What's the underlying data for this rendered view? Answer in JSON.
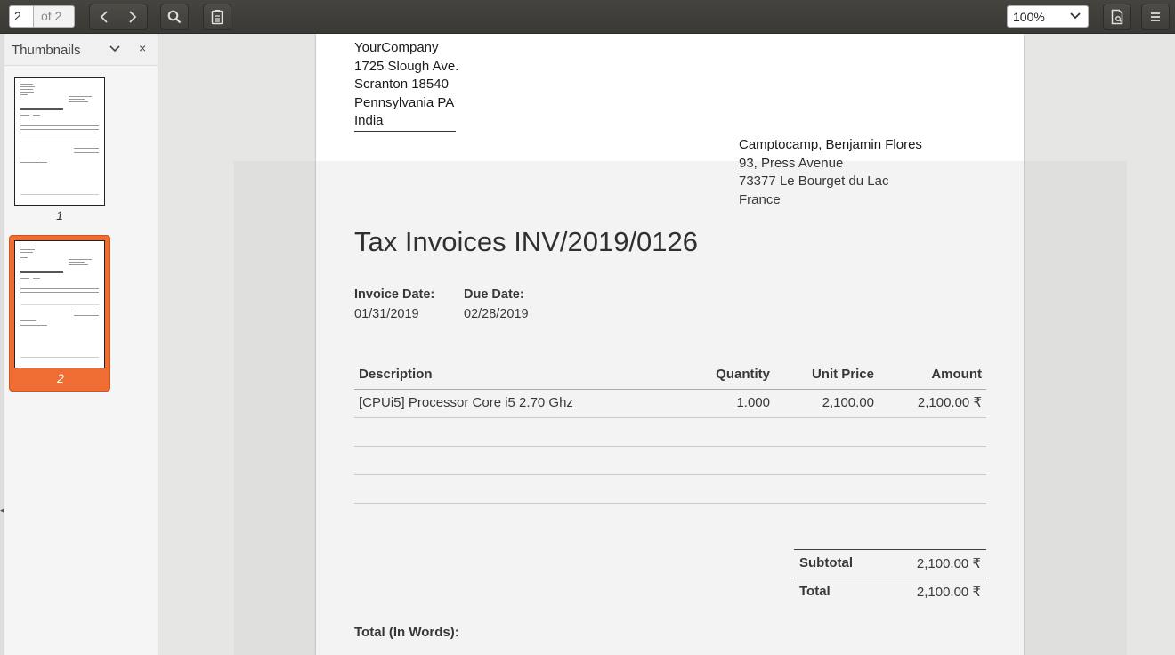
{
  "toolbar": {
    "page_current": "2",
    "page_of": "of 2",
    "zoom": "100%",
    "icons": [
      "chevron-left-icon",
      "chevron-right-icon",
      "search-icon",
      "annotations-icon",
      "document-properties-icon",
      "hamburger-menu-icon"
    ]
  },
  "sidebar": {
    "title": "Thumbnails",
    "thumbnails": [
      {
        "label": "1",
        "selected": false
      },
      {
        "label": "2",
        "selected": true
      }
    ]
  },
  "document": {
    "company": {
      "name": "YourCompany",
      "street": "1725 Slough Ave.",
      "city": "Scranton 18540",
      "state": "Pennsylvania PA",
      "country": "India"
    },
    "customer": {
      "name": "Camptocamp, Benjamin Flores",
      "street": "93, Press Avenue",
      "city": "73377 Le Bourget du Lac",
      "country": "France"
    },
    "title": "Tax Invoices INV/2019/0126",
    "invoice_date_label": "Invoice Date:",
    "invoice_date": "01/31/2019",
    "due_date_label": "Due Date:",
    "due_date": "02/28/2019",
    "table": {
      "headers": [
        "Description",
        "Quantity",
        "Unit Price",
        "Amount"
      ],
      "rows": [
        [
          "[CPUi5] Processor Core i5 2.70 Ghz",
          "1.000",
          "2,100.00",
          "2,100.00 ₹"
        ]
      ]
    },
    "subtotal_label": "Subtotal",
    "subtotal_value": "2,100.00 ₹",
    "total_label": "Total",
    "total_value": "2,100.00 ₹",
    "total_words_label": "Total (In Words):"
  }
}
